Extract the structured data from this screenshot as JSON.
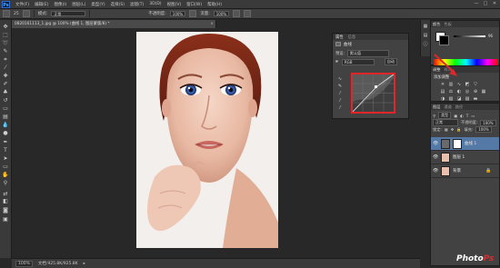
{
  "app": {
    "logo": "Ps",
    "menu": [
      "文件(F)",
      "编辑(E)",
      "图像(I)",
      "图层(L)",
      "类型(Y)",
      "选择(S)",
      "滤镜(T)",
      "3D(D)",
      "视图(V)",
      "窗口(W)",
      "帮助(H)"
    ],
    "window_controls": [
      "—",
      "□",
      "✕"
    ]
  },
  "options_bar": {
    "brush_size": "25",
    "mode_label": "模式:",
    "mode_value": "正常",
    "opacity_label": "不透明度:",
    "opacity_value": "100%",
    "flow_label": "流量:",
    "flow_value": "100%"
  },
  "document": {
    "tab_title": "0820161113_1.jpg @ 100% (曲线 1, 图层蒙版/8) *",
    "close": "×"
  },
  "status_bar": {
    "zoom": "100%",
    "doc_info": "文档:925.8K/925.8K"
  },
  "properties_panel": {
    "tab_active": "属性",
    "tab_inactive": "信息",
    "title": "曲线",
    "preset_label": "预设:",
    "preset_value": "默认值",
    "channel_value": "RGB",
    "auto_label": "自动"
  },
  "color_panel": {
    "tab_active": "颜色",
    "tab_inactive": "色板",
    "value": "96",
    "fg_color": "#ffffff",
    "bg_color": "#000000"
  },
  "adjustments_panel": {
    "tab_active": "调整",
    "tab_inactive": "样式",
    "title": "添加调整"
  },
  "layers_panel": {
    "tabs": [
      "图层",
      "通道",
      "路径"
    ],
    "kind_label": "类型",
    "blend_mode": "正常",
    "opacity_label": "不透明度:",
    "opacity_value": "100%",
    "lock_label": "锁定:",
    "fill_label": "填充:",
    "fill_value": "100%",
    "layers": [
      {
        "name": "曲线 1",
        "type": "adjustment",
        "selected": true
      },
      {
        "name": "图层 1",
        "type": "image",
        "selected": false
      },
      {
        "name": "背景",
        "type": "image",
        "selected": false
      }
    ]
  },
  "watermark": {
    "text_a": "Photo",
    "text_b": "Ps"
  },
  "colors": {
    "highlight_red": "#e0262a",
    "selection_blue": "#5479a6"
  }
}
